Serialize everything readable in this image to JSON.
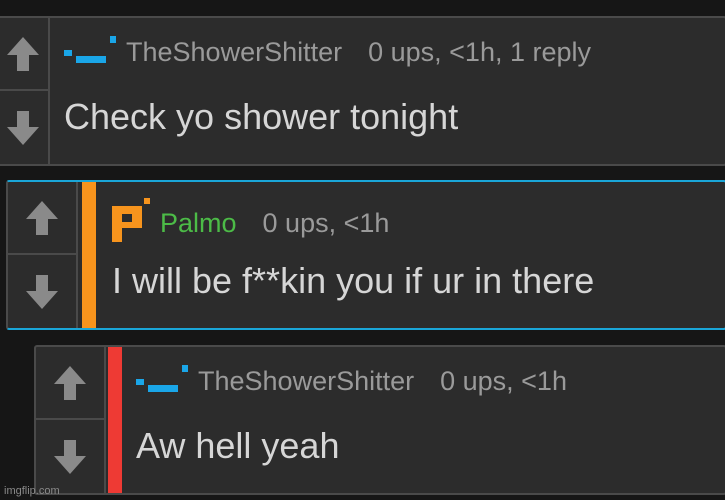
{
  "comments": [
    {
      "username": "TheShowerShitter",
      "meta": "0 ups, <1h, 1 reply",
      "text": "Check yo shower tonight",
      "username_color": "#9a9a9a",
      "avatar_icon": "pixel-dash-avatar-icon",
      "depth_bar_color": null
    },
    {
      "username": "Palmo",
      "meta": "0 ups, <1h",
      "text": "I will be f**kin you if ur in there",
      "username_color": "#4cbb47",
      "avatar_icon": "pixel-p-avatar-icon",
      "depth_bar_color": "#f7941d",
      "highlight_border_color": "#1aa6d8"
    },
    {
      "username": "TheShowerShitter",
      "meta": "0 ups, <1h",
      "text": "Aw hell yeah",
      "username_color": "#9a9a9a",
      "avatar_icon": "pixel-dash-avatar-icon",
      "depth_bar_color": "#ee3a34"
    }
  ],
  "vote_icons": {
    "up": "up-arrow-icon",
    "down": "down-arrow-icon",
    "color": "#8a8a8a"
  },
  "watermark": "imgflip.com"
}
